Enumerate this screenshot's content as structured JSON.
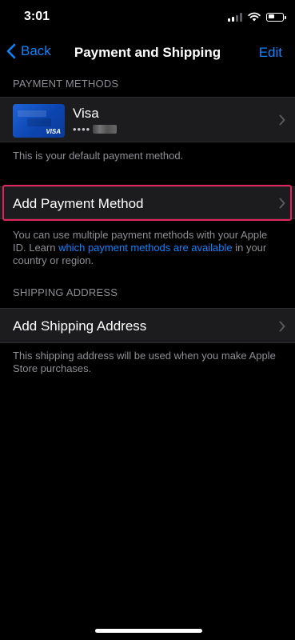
{
  "status_bar": {
    "time": "3:01"
  },
  "nav": {
    "back_label": "Back",
    "title": "Payment and Shipping",
    "edit_label": "Edit"
  },
  "payment_section": {
    "header": "PAYMENT METHODS",
    "card": {
      "name": "Visa",
      "masked_number": "••••",
      "card_brand": "VISA"
    },
    "default_note": "This is your default payment method."
  },
  "add_payment": {
    "label": "Add Payment Method",
    "footer_prefix": "You can use multiple payment methods with your Apple ID. Learn ",
    "footer_link": "which payment methods are available",
    "footer_suffix": " in your country or region."
  },
  "shipping_section": {
    "header": "SHIPPING ADDRESS",
    "add_label": "Add Shipping Address",
    "footer": "This shipping address will be used when you make Apple Store purchases."
  },
  "colors": {
    "background": "#000000",
    "cell": "#1c1c1e",
    "accent": "#0a84ff",
    "secondary_text": "#8e8e93",
    "highlight": "#e0245e"
  }
}
